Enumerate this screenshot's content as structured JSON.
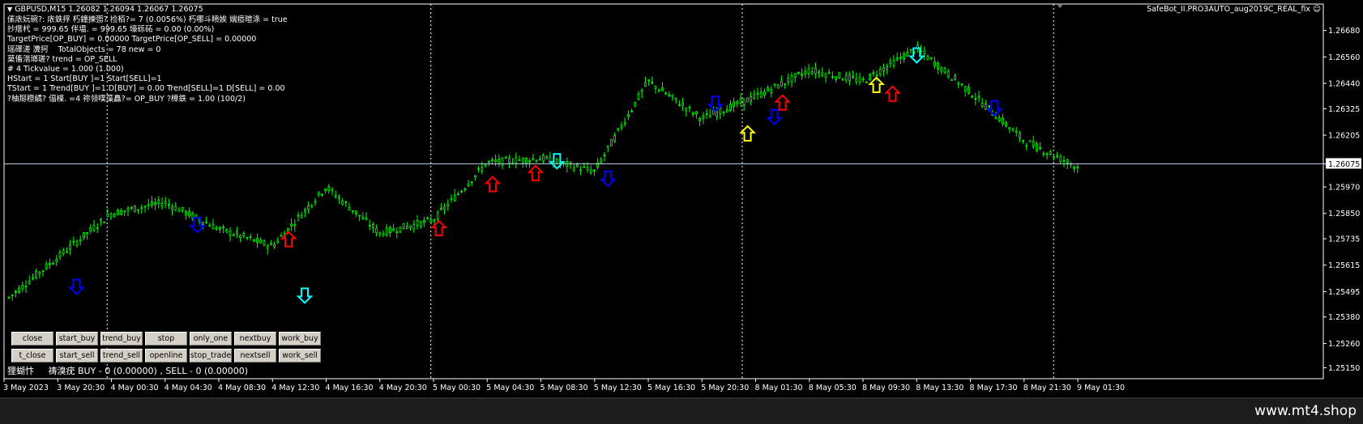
{
  "window": {
    "symbol_header": "GBPUSD,M15  1.26082 1.26094 1.26067 1.26075",
    "ea_name": "SafeBot_II.PRO3AUTO_aug2019C_REAL_fix",
    "smiley": "☺",
    "current_price": "1.26075",
    "footer": "www.mt4.shop"
  },
  "info_lines": [
    "傃庡妧碗?: 庡鉄捊 朽鐘揀彅? 捡栢?= 7 (0.0056%) 朽哪斗瞆娭 媏瘂暄涤 = true",
    "抄瘔杙 = 999.65 伴塭. = 999.65 壕砾砳 = 0.00 (0.00%)",
    "TargetPrice[OP_BUY] = 0.00000 TargetPrice[OP_SELL] = 0.00000",
    "瑶礋溠 瀵抲    TotalObjects = 78 new = 0",
    "菒傗湝瑯瑳? trend = OP_SELL",
    "# 4 Tickvalue = 1.000 (1.000)",
    "HStart = 1 Start[BUY ]=1 Start[SELL]=1",
    "TStart = 1 Trend[BUY ]=1 D[BUY] = 0.00 Trend[SELL]=1 D[SELL] = 0.00",
    "?柚搿穄繘? 偪檪. =4 祢领噗藻矗?= OP_BUY ?樟鉄 = 1.00 (100/2)"
  ],
  "buttons": [
    [
      "close",
      "start_buy",
      "trend_buy",
      "stop",
      "only_one",
      "nextbuy",
      "work_buy"
    ],
    [
      "t_close",
      "start_sell",
      "trend_sell",
      "openline",
      "stop_trade",
      "nextsell",
      "work_sell"
    ]
  ],
  "status_text": "狸蝴忭     祷溴疣 BUY - 0 (0.00000) , SELL - 0 (0.00000)",
  "price_axis": [
    "1.26680",
    "1.26560",
    "1.26440",
    "1.26325",
    "1.26205",
    "1.26075",
    "1.25970",
    "1.25850",
    "1.25735",
    "1.25615",
    "1.25495",
    "1.25380",
    "1.25260",
    "1.25150"
  ],
  "time_axis": [
    "3 May 2023",
    "3 May 20:30",
    "4 May 00:30",
    "4 May 04:30",
    "4 May 08:30",
    "4 May 12:30",
    "4 May 16:30",
    "4 May 20:30",
    "5 May 00:30",
    "5 May 04:30",
    "5 May 08:30",
    "5 May 12:30",
    "5 May 16:30",
    "5 May 20:30",
    "8 May 01:30",
    "8 May 05:30",
    "8 May 09:30",
    "8 May 13:30",
    "8 May 17:30",
    "8 May 21:30",
    "9 May 01:30"
  ],
  "chart_data": {
    "type": "line",
    "x": [
      "3 May 2023",
      "3 May 20:30",
      "4 May 00:30",
      "4 May 04:30",
      "4 May 08:30",
      "4 May 12:30",
      "4 May 16:30",
      "4 May 20:30",
      "5 May 00:30",
      "5 May 04:30",
      "5 May 08:30",
      "5 May 12:30",
      "5 May 16:30",
      "5 May 20:30",
      "8 May 01:30",
      "8 May 05:30",
      "8 May 09:30",
      "8 May 13:30",
      "8 May 17:30",
      "8 May 21:30",
      "9 May 01:30"
    ],
    "series": [
      {
        "values": [
          1.2545,
          1.2565,
          1.2585,
          1.259,
          1.2578,
          1.257,
          1.2597,
          1.2576,
          1.2582,
          1.2608,
          1.261,
          1.2604,
          1.2645,
          1.2628,
          1.2638,
          1.265,
          1.2645,
          1.266,
          1.264,
          1.2618,
          1.2606
        ]
      }
    ],
    "ylim": [
      1.251,
      1.268
    ],
    "last_price": 1.26075,
    "colors": {
      "candles": "#00ff00",
      "grid": "#ffffff",
      "bid_line": "#b0c4de",
      "axis": "#ffffff"
    },
    "arrows": [
      {
        "i": 1.35,
        "dir": "down",
        "color": "#0000ff",
        "price": 1.2555
      },
      {
        "i": 3.6,
        "dir": "down",
        "color": "#0000ff",
        "price": 1.2583
      },
      {
        "i": 5.3,
        "dir": "up",
        "color": "#ff0000",
        "price": 1.257
      },
      {
        "i": 5.6,
        "dir": "down",
        "color": "#00ffff",
        "price": 1.2551
      },
      {
        "i": 8.1,
        "dir": "up",
        "color": "#ff0000",
        "price": 1.2575
      },
      {
        "i": 9.1,
        "dir": "up",
        "color": "#ff0000",
        "price": 1.2595
      },
      {
        "i": 9.9,
        "dir": "up",
        "color": "#ff0000",
        "price": 1.26
      },
      {
        "i": 10.3,
        "dir": "down",
        "color": "#00ffff",
        "price": 1.2612
      },
      {
        "i": 11.25,
        "dir": "down",
        "color": "#0000ff",
        "price": 1.2604
      },
      {
        "i": 13.25,
        "dir": "down",
        "color": "#0000ff",
        "price": 1.2638
      },
      {
        "i": 13.85,
        "dir": "up",
        "color": "#ffff00",
        "price": 1.2618
      },
      {
        "i": 14.35,
        "dir": "down",
        "color": "#0000ff",
        "price": 1.2632
      },
      {
        "i": 14.5,
        "dir": "up",
        "color": "#ff0000",
        "price": 1.2632
      },
      {
        "i": 16.25,
        "dir": "up",
        "color": "#ffff00",
        "price": 1.264
      },
      {
        "i": 16.55,
        "dir": "up",
        "color": "#ff0000",
        "price": 1.2636
      },
      {
        "i": 17.0,
        "dir": "down",
        "color": "#00ffff",
        "price": 1.266
      },
      {
        "i": 18.45,
        "dir": "down",
        "color": "#0000ff",
        "price": 1.2636
      }
    ]
  }
}
